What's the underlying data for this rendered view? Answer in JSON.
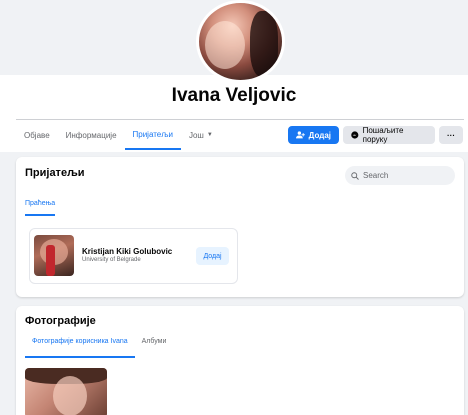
{
  "profile": {
    "name": "Ivana Veljovic"
  },
  "nav": {
    "tabs": [
      {
        "label": "Објаве"
      },
      {
        "label": "Информације"
      },
      {
        "label": "Пријатељи"
      },
      {
        "label": "Још"
      }
    ],
    "active_tab": "Пријатељи"
  },
  "actions": {
    "add_label": "Додај",
    "message_label": "Пошаљите поруку",
    "more_label": "···"
  },
  "friends": {
    "title": "Пријатељи",
    "search_placeholder": "Search",
    "subtab": "Праћења",
    "items": [
      {
        "name": "Kristijan Kiki Golubovic",
        "subtitle": "University of Belgrade",
        "button": "Додај"
      }
    ]
  },
  "photos": {
    "title": "Фотографије",
    "tabs": [
      {
        "label": "Фотографије корисникa Ivana"
      },
      {
        "label": "Албуми"
      }
    ]
  },
  "colors": {
    "accent": "#1877f2",
    "background": "#f0f2f5",
    "card": "#ffffff",
    "secondary_button": "#e4e6eb",
    "light_accent": "#e7f3ff"
  },
  "icons": {
    "add_friend": "person-plus-icon",
    "messenger": "messenger-icon",
    "search": "search-icon",
    "dropdown": "caret-down-icon"
  }
}
